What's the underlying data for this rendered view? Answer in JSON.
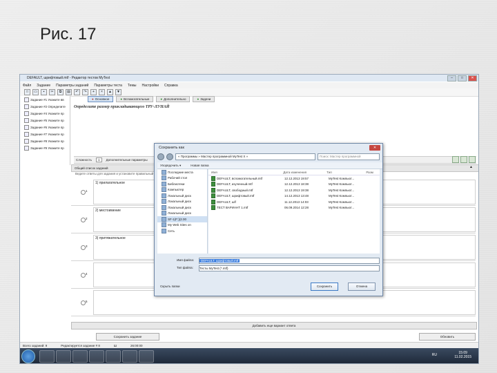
{
  "slide": {
    "title": "Рис. 17"
  },
  "window": {
    "title": "DEFAULT, шрифтовый.mtf - Редактор тестов MyTest"
  },
  "menu": [
    "Файл",
    "Задание",
    "Параметры заданий",
    "Параметры теста",
    "Темы",
    "Настройки",
    "Справка"
  ],
  "tabs": [
    {
      "label": "Основное"
    },
    {
      "label": "Вспомогательные"
    },
    {
      "label": "Дополнительно"
    },
    {
      "label": "Задачи"
    }
  ],
  "tasks": [
    "Задание #1 Укажите вв",
    "Задание #2 Определите",
    "Задание #4 Укажите пр",
    "Задание #5 Укажите пр",
    "Задание #6 Укажите пр",
    "Задание #7 Укажите пр",
    "Задание #8 Укажите пр",
    "Задание #9 Укажите пр"
  ],
  "question": {
    "heading": "Определите размер прикладывающего ТРУ-ЛУНАЙ"
  },
  "task_bar": {
    "num_label": "Сложность",
    "num_value": "1",
    "extra": "Дополнительные параметры"
  },
  "section": {
    "label": "Общий список заданий",
    "collapse": "▲"
  },
  "subhead": "Ведите ответы для задания и установите правильный",
  "answers": [
    {
      "n": "1",
      "text": "1) прилагательное"
    },
    {
      "n": "2",
      "text": "2) местоимение"
    },
    {
      "n": "3",
      "text": "3) притяжательное"
    },
    {
      "n": "4",
      "text": ""
    },
    {
      "n": "5",
      "text": ""
    }
  ],
  "add_answer": "Добавить еще вариант ответа",
  "bottom": {
    "left": "Сохранить задание",
    "right": "Обновить"
  },
  "status": [
    "Всего заданий: 9",
    "Редактируется задание # 8",
    "Ш",
    "26:00:00"
  ],
  "dialog": {
    "title": "Сохранить как",
    "address": "« Программы » Мастер программной MyTest X »",
    "search": "Поиск: Мастер программной",
    "toolbar": [
      "Упорядочить ▾",
      "Новая папка"
    ],
    "nav": [
      "Последние места",
      "Рабочий стол",
      "Библиотеки",
      "Компьютер",
      "Локальный диск",
      "Локальный диск",
      "Локальный диск",
      "Локальный диск",
      "SF-1(F:)(2.00",
      "My Web Sites on",
      "Сеть"
    ],
    "columns": [
      "Имя",
      "Дата изменения",
      "Тип",
      "Разм"
    ],
    "files": [
      {
        "name": "DEFAULT, вспомогательный.mtf",
        "date": "12.12.2013 19:57",
        "type": "MyTest Компьют..."
      },
      {
        "name": "DEFAULT, изученный.mtf",
        "date": "12.12.2013 18:38",
        "type": "MyTest Компьют..."
      },
      {
        "name": "DEFAULT, свободный.mtf",
        "date": "12.12.2013 19:38",
        "type": "MyTest Компьют..."
      },
      {
        "name": "DEFAULT, шрифтовый.mtf",
        "date": "14.12.2013 13:48",
        "type": "MyTest Компьют..."
      },
      {
        "name": "DEFAULT, шlf",
        "date": "11.12.2013 14:03",
        "type": "MyTest Компьют..."
      },
      {
        "name": "ТЕСТ ВАРИАНТ 1.mtf",
        "date": "06.09.2014 12:28",
        "type": "MyTest Компьют..."
      }
    ],
    "filename_label": "Имя файла:",
    "filename": "DEFAULT, шрифтовый.mtf",
    "filetype_label": "Тип файла:",
    "filetype": "Тесты MyTest (*.mtf)",
    "hide_folders": "Скрыть папки",
    "save": "Сохранить",
    "cancel": "Отмена"
  },
  "taskbar": {
    "lang": "RU",
    "time": "15:09",
    "date": "11.02.2015"
  }
}
